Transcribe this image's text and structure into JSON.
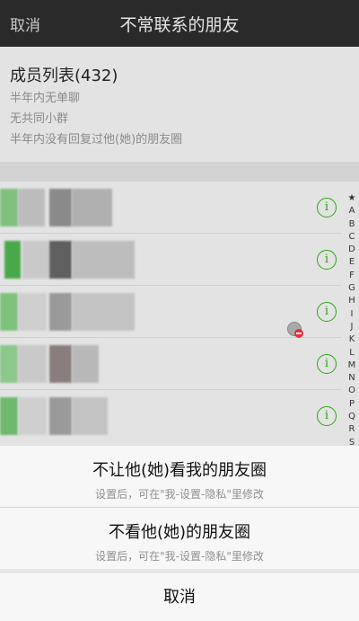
{
  "nav": {
    "cancel_label": "取消",
    "title": "不常联系的朋友"
  },
  "header": {
    "member_list_title": "成员列表(432)",
    "criteria": [
      "半年内无单聊",
      "无共同小群",
      "半年内没有回复过他(她)的朋友圈"
    ]
  },
  "index_letters": [
    "★",
    "A",
    "B",
    "C",
    "D",
    "E",
    "F",
    "G",
    "H",
    "I",
    "J",
    "K",
    "L",
    "M",
    "N",
    "O",
    "P",
    "Q",
    "R",
    "S"
  ],
  "rows": [
    {
      "info_icon": "info-icon"
    },
    {
      "info_icon": "info-icon"
    },
    {
      "info_icon": "info-icon",
      "status_icon": "muted-icon"
    },
    {
      "info_icon": "info-icon"
    },
    {
      "info_icon": "info-icon"
    }
  ],
  "sheet": {
    "option1": {
      "title": "不让他(她)看我的朋友圈",
      "subtitle": "设置后，可在\"我-设置-隐私\"里修改"
    },
    "option2": {
      "title": "不看他(她)的朋友圈",
      "subtitle": "设置后，可在\"我-设置-隐私\"里修改"
    },
    "cancel_label": "取消"
  },
  "colors": {
    "accent_green": "#2aa515",
    "nav_bg": "#2a2a2a",
    "badge_red": "#e0303a"
  }
}
